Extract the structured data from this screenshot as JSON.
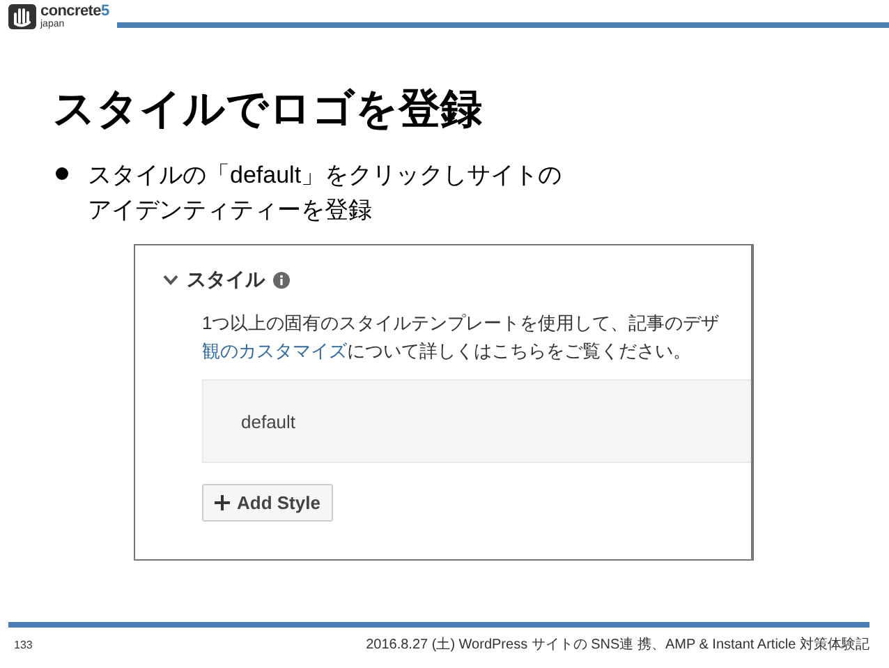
{
  "header": {
    "logo_word": "concrete",
    "logo_digit": "5",
    "logo_sub": "japan"
  },
  "title": "スタイルでロゴを登録",
  "bullets": [
    {
      "lines": [
        "スタイルの「default」をクリックしサイトの",
        "アイデンティティーを登録"
      ]
    }
  ],
  "screenshot": {
    "section": {
      "title": "スタイル",
      "expanded": true
    },
    "description": {
      "before": "1つ以上の固有のスタイルテンプレートを使用して、記事のデザ",
      "link": "観のカスタマイズ",
      "after": "について詳しくはこちらをご覧ください。"
    },
    "styles": [
      "default"
    ],
    "add_button": "Add Style"
  },
  "footer": {
    "page": "133",
    "caption": "2016.8.27 (土) WordPress サイトの SNS連 携、AMP & Instant Article 対策体験記"
  }
}
